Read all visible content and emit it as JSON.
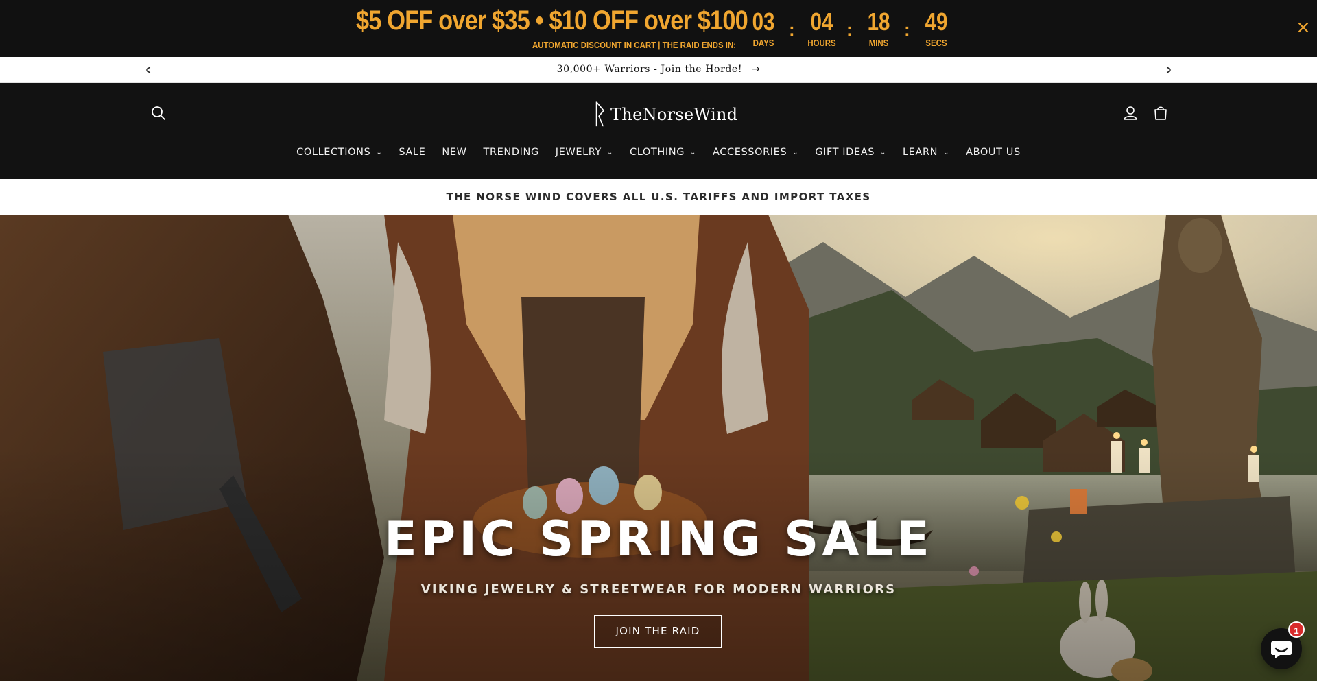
{
  "promo": {
    "headline": "$5 OFF over $35 • $10 OFF over $100",
    "subtext": "AUTOMATIC DISCOUNT IN CART | THE RAID ENDS IN:",
    "countdown": [
      {
        "value": "03",
        "label": "DAYS"
      },
      {
        "value": "04",
        "label": "HOURS"
      },
      {
        "value": "18",
        "label": "MINS"
      },
      {
        "value": "49",
        "label": "SECS"
      }
    ],
    "separator": ":",
    "close_icon": "close-icon",
    "accent_color": "#f0a630"
  },
  "announcement": {
    "text": "30,000+ Warriors - Join the Horde!",
    "prev_icon": "chevron-left-icon",
    "next_icon": "chevron-right-icon",
    "link_arrow": "→"
  },
  "header": {
    "logo_rune": "ᚱ",
    "logo_text": "TheNorseWind",
    "search_icon": "search-icon",
    "account_icon": "user-icon",
    "cart_icon": "cart-icon",
    "nav": [
      {
        "label": "COLLECTIONS",
        "dropdown": true
      },
      {
        "label": "SALE",
        "dropdown": false
      },
      {
        "label": "NEW",
        "dropdown": false
      },
      {
        "label": "TRENDING",
        "dropdown": false
      },
      {
        "label": "JEWELRY",
        "dropdown": true
      },
      {
        "label": "CLOTHING",
        "dropdown": true
      },
      {
        "label": "ACCESSORIES",
        "dropdown": true
      },
      {
        "label": "GIFT IDEAS",
        "dropdown": true
      },
      {
        "label": "LEARN",
        "dropdown": true
      },
      {
        "label": "ABOUT US",
        "dropdown": false
      }
    ]
  },
  "tariff": {
    "text": "THE NORSE WIND COVERS ALL U.S. TARIFFS AND IMPORT TAXES"
  },
  "hero": {
    "title": "EPIC SPRING SALE",
    "subtitle": "VIKING JEWELRY & STREETWEAR FOR MODERN WARRIORS",
    "cta": "JOIN THE RAID"
  },
  "chat": {
    "icon": "chat-icon",
    "badge": "1"
  }
}
